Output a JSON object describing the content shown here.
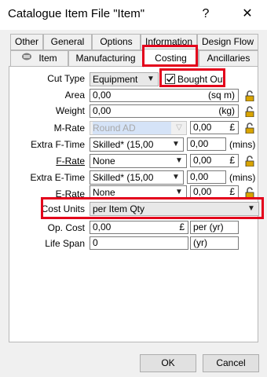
{
  "window": {
    "title": "Catalogue Item File \"Item\"",
    "help_glyph": "?",
    "close_glyph": "✕"
  },
  "tabs_row1": [
    "Other",
    "General",
    "Options",
    "Information",
    "Design Flow"
  ],
  "tabs_row2": [
    "Item",
    "Manufacturing",
    "Costing",
    "Ancillaries"
  ],
  "form": {
    "cut_type": {
      "label": "Cut Type",
      "value": "Equipment",
      "bought_out_label": "Bought Out",
      "bought_out_checked": true
    },
    "area": {
      "label": "Area",
      "value": "0,00",
      "unit": "(sq m)"
    },
    "weight": {
      "label": "Weight",
      "value": "0,00",
      "unit": "(kg)"
    },
    "m_rate": {
      "label": "M-Rate",
      "value": "Round AD",
      "amount": "0,00",
      "currency": "£"
    },
    "extra_f_time": {
      "label": "Extra F-Time",
      "value": "Skilled* (15,00",
      "amount": "0,00",
      "unit": "(mins)"
    },
    "f_rate": {
      "label": "F-Rate",
      "value": "None",
      "amount": "0,00",
      "currency": "£"
    },
    "extra_e_time": {
      "label": "Extra E-Time",
      "value": "Skilled* (15,00",
      "amount": "0,00",
      "unit": "(mins)"
    },
    "e_rate": {
      "label": "E-Rate",
      "value": "None",
      "amount": "0,00",
      "currency": "£"
    },
    "cost_units": {
      "label": "Cost Units",
      "value": "per Item Qty"
    },
    "op_cost": {
      "label": "Op. Cost",
      "value": "0,00",
      "currency": "£",
      "unit": "per (yr)"
    },
    "life_span": {
      "label": "Life Span",
      "value": "0",
      "unit": "(yr)"
    }
  },
  "buttons": {
    "ok": "OK",
    "cancel": "Cancel"
  },
  "colors": {
    "highlight": "#e3001b",
    "lock_gold": "#d9a400"
  },
  "icons": [
    "help-icon",
    "close-icon",
    "item-tab-icon",
    "chevron-down-icon",
    "lock-icon"
  ]
}
